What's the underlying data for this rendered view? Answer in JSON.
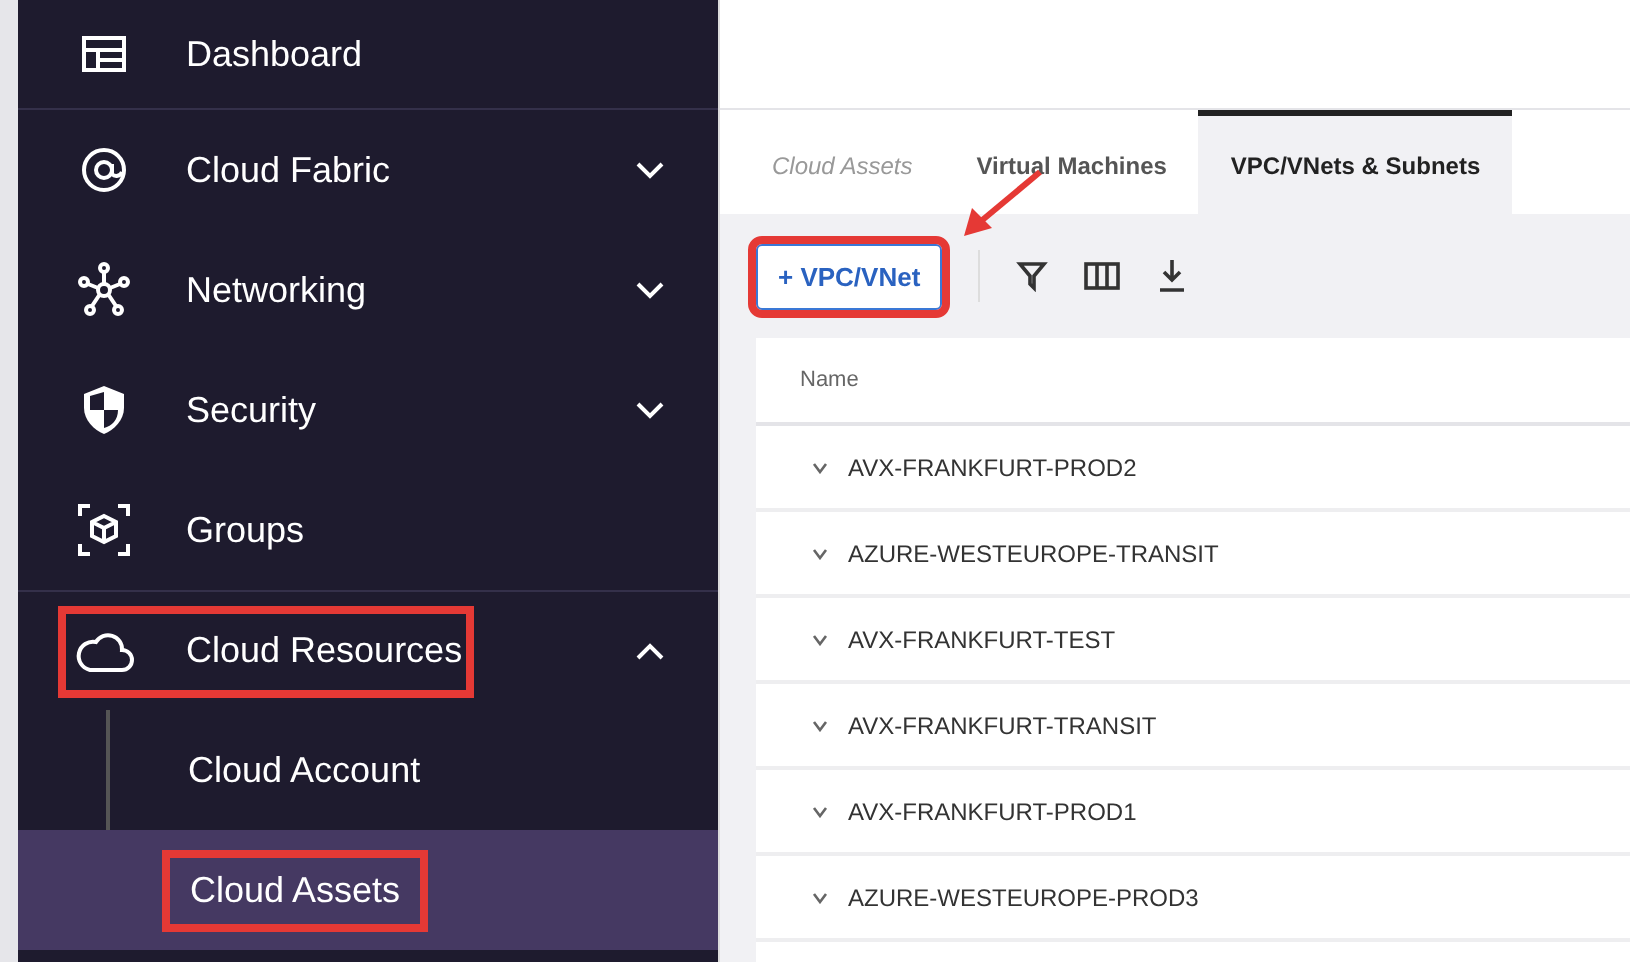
{
  "sidebar": {
    "items": [
      {
        "label": "Dashboard",
        "selected": false,
        "highlighted": false
      },
      {
        "label": "Cloud Fabric",
        "selected": false,
        "highlighted": false,
        "expanded": false
      },
      {
        "label": "Networking",
        "selected": false,
        "highlighted": false,
        "expanded": false
      },
      {
        "label": "Security",
        "selected": false,
        "highlighted": false,
        "expanded": false
      },
      {
        "label": "Groups",
        "selected": false,
        "highlighted": false
      },
      {
        "label": "Cloud Resources",
        "selected": false,
        "highlighted": true,
        "expanded": true,
        "children": [
          {
            "label": "Cloud Account",
            "selected": false,
            "highlighted": false
          },
          {
            "label": "Cloud Assets",
            "selected": true,
            "highlighted": true
          }
        ]
      }
    ]
  },
  "tabs": [
    {
      "label": "Cloud Assets",
      "kind": "crumb",
      "selected": false
    },
    {
      "label": "Virtual Machines",
      "kind": "tab",
      "selected": false
    },
    {
      "label": "VPC/VNets & Subnets",
      "kind": "tab",
      "selected": true
    }
  ],
  "toolbar": {
    "add_button": {
      "label": "+ VPC/VNet",
      "highlighted": true
    }
  },
  "table": {
    "columns": [
      "Name"
    ],
    "rows": [
      {
        "name": "AVX-FRANKFURT-PROD2",
        "expanded": false
      },
      {
        "name": "AZURE-WESTEUROPE-TRANSIT",
        "expanded": false
      },
      {
        "name": "AVX-FRANKFURT-TEST",
        "expanded": false
      },
      {
        "name": "AVX-FRANKFURT-TRANSIT",
        "expanded": false
      },
      {
        "name": "AVX-FRANKFURT-PROD1",
        "expanded": false
      },
      {
        "name": "AZURE-WESTEUROPE-PROD3",
        "expanded": false
      }
    ]
  }
}
